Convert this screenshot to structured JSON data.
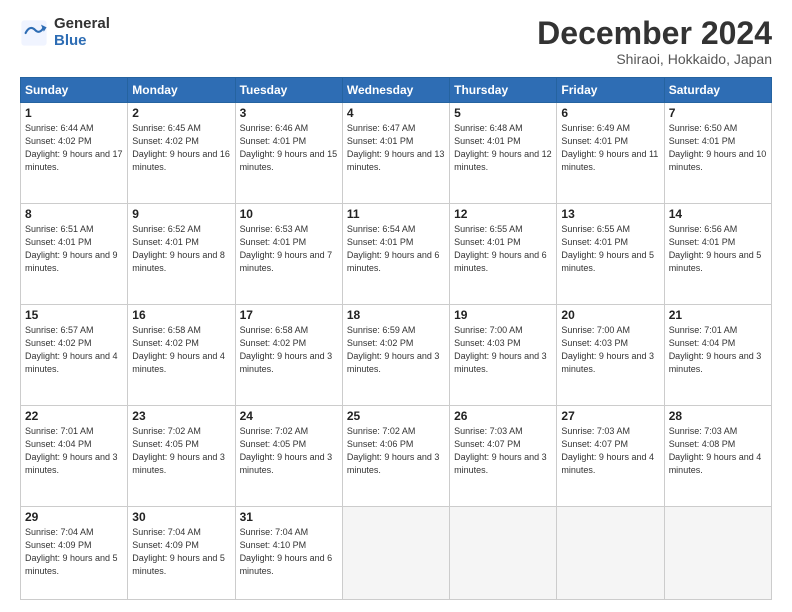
{
  "logo": {
    "general": "General",
    "blue": "Blue"
  },
  "header": {
    "month": "December 2024",
    "location": "Shiraoi, Hokkaido, Japan"
  },
  "weekdays": [
    "Sunday",
    "Monday",
    "Tuesday",
    "Wednesday",
    "Thursday",
    "Friday",
    "Saturday"
  ],
  "weeks": [
    [
      {
        "day": "1",
        "info": "Sunrise: 6:44 AM\nSunset: 4:02 PM\nDaylight: 9 hours and 17 minutes."
      },
      {
        "day": "2",
        "info": "Sunrise: 6:45 AM\nSunset: 4:02 PM\nDaylight: 9 hours and 16 minutes."
      },
      {
        "day": "3",
        "info": "Sunrise: 6:46 AM\nSunset: 4:01 PM\nDaylight: 9 hours and 15 minutes."
      },
      {
        "day": "4",
        "info": "Sunrise: 6:47 AM\nSunset: 4:01 PM\nDaylight: 9 hours and 13 minutes."
      },
      {
        "day": "5",
        "info": "Sunrise: 6:48 AM\nSunset: 4:01 PM\nDaylight: 9 hours and 12 minutes."
      },
      {
        "day": "6",
        "info": "Sunrise: 6:49 AM\nSunset: 4:01 PM\nDaylight: 9 hours and 11 minutes."
      },
      {
        "day": "7",
        "info": "Sunrise: 6:50 AM\nSunset: 4:01 PM\nDaylight: 9 hours and 10 minutes."
      }
    ],
    [
      {
        "day": "8",
        "info": "Sunrise: 6:51 AM\nSunset: 4:01 PM\nDaylight: 9 hours and 9 minutes."
      },
      {
        "day": "9",
        "info": "Sunrise: 6:52 AM\nSunset: 4:01 PM\nDaylight: 9 hours and 8 minutes."
      },
      {
        "day": "10",
        "info": "Sunrise: 6:53 AM\nSunset: 4:01 PM\nDaylight: 9 hours and 7 minutes."
      },
      {
        "day": "11",
        "info": "Sunrise: 6:54 AM\nSunset: 4:01 PM\nDaylight: 9 hours and 6 minutes."
      },
      {
        "day": "12",
        "info": "Sunrise: 6:55 AM\nSunset: 4:01 PM\nDaylight: 9 hours and 6 minutes."
      },
      {
        "day": "13",
        "info": "Sunrise: 6:55 AM\nSunset: 4:01 PM\nDaylight: 9 hours and 5 minutes."
      },
      {
        "day": "14",
        "info": "Sunrise: 6:56 AM\nSunset: 4:01 PM\nDaylight: 9 hours and 5 minutes."
      }
    ],
    [
      {
        "day": "15",
        "info": "Sunrise: 6:57 AM\nSunset: 4:02 PM\nDaylight: 9 hours and 4 minutes."
      },
      {
        "day": "16",
        "info": "Sunrise: 6:58 AM\nSunset: 4:02 PM\nDaylight: 9 hours and 4 minutes."
      },
      {
        "day": "17",
        "info": "Sunrise: 6:58 AM\nSunset: 4:02 PM\nDaylight: 9 hours and 3 minutes."
      },
      {
        "day": "18",
        "info": "Sunrise: 6:59 AM\nSunset: 4:02 PM\nDaylight: 9 hours and 3 minutes."
      },
      {
        "day": "19",
        "info": "Sunrise: 7:00 AM\nSunset: 4:03 PM\nDaylight: 9 hours and 3 minutes."
      },
      {
        "day": "20",
        "info": "Sunrise: 7:00 AM\nSunset: 4:03 PM\nDaylight: 9 hours and 3 minutes."
      },
      {
        "day": "21",
        "info": "Sunrise: 7:01 AM\nSunset: 4:04 PM\nDaylight: 9 hours and 3 minutes."
      }
    ],
    [
      {
        "day": "22",
        "info": "Sunrise: 7:01 AM\nSunset: 4:04 PM\nDaylight: 9 hours and 3 minutes."
      },
      {
        "day": "23",
        "info": "Sunrise: 7:02 AM\nSunset: 4:05 PM\nDaylight: 9 hours and 3 minutes."
      },
      {
        "day": "24",
        "info": "Sunrise: 7:02 AM\nSunset: 4:05 PM\nDaylight: 9 hours and 3 minutes."
      },
      {
        "day": "25",
        "info": "Sunrise: 7:02 AM\nSunset: 4:06 PM\nDaylight: 9 hours and 3 minutes."
      },
      {
        "day": "26",
        "info": "Sunrise: 7:03 AM\nSunset: 4:07 PM\nDaylight: 9 hours and 3 minutes."
      },
      {
        "day": "27",
        "info": "Sunrise: 7:03 AM\nSunset: 4:07 PM\nDaylight: 9 hours and 4 minutes."
      },
      {
        "day": "28",
        "info": "Sunrise: 7:03 AM\nSunset: 4:08 PM\nDaylight: 9 hours and 4 minutes."
      }
    ],
    [
      {
        "day": "29",
        "info": "Sunrise: 7:04 AM\nSunset: 4:09 PM\nDaylight: 9 hours and 5 minutes."
      },
      {
        "day": "30",
        "info": "Sunrise: 7:04 AM\nSunset: 4:09 PM\nDaylight: 9 hours and 5 minutes."
      },
      {
        "day": "31",
        "info": "Sunrise: 7:04 AM\nSunset: 4:10 PM\nDaylight: 9 hours and 6 minutes."
      },
      null,
      null,
      null,
      null
    ]
  ]
}
